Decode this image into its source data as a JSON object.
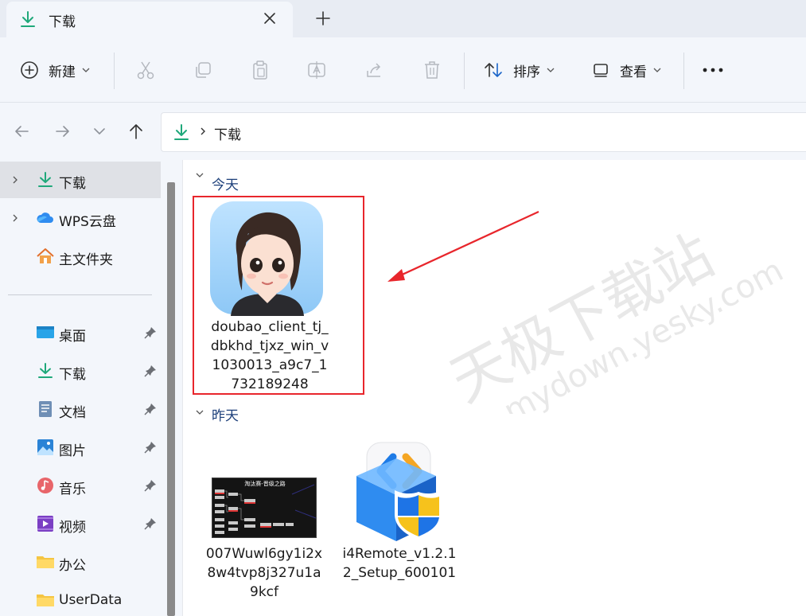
{
  "window": {
    "tab_title": "下载",
    "colors": {
      "accent_green": "#1fa87a",
      "selection_red": "#e8262c",
      "group_title": "#1c3f7a"
    }
  },
  "toolbar": {
    "new_label": "新建",
    "sort_label": "排序",
    "view_label": "查看"
  },
  "address": {
    "path": "下载"
  },
  "sidebar": {
    "items": [
      {
        "label": "下载",
        "icon": "download-arrow-icon"
      },
      {
        "label": "WPS云盘",
        "icon": "cloud-icon"
      },
      {
        "label": "主文件夹",
        "icon": "home-icon"
      },
      {
        "label": "桌面",
        "icon": "desktop-icon"
      },
      {
        "label": "下载",
        "icon": "download-arrow-icon"
      },
      {
        "label": "文档",
        "icon": "document-icon"
      },
      {
        "label": "图片",
        "icon": "picture-icon"
      },
      {
        "label": "音乐",
        "icon": "music-icon"
      },
      {
        "label": "视频",
        "icon": "video-icon"
      },
      {
        "label": "办公",
        "icon": "folder-icon"
      },
      {
        "label": "UserData",
        "icon": "folder-icon"
      }
    ]
  },
  "groups": {
    "today": {
      "title": "今天",
      "files": [
        {
          "name": "doubao_client_tj_dbkhd_tjxz_win_v1030013_a9c7_1732189248",
          "icon": "doubao-avatar-icon"
        }
      ]
    },
    "yesterday": {
      "title": "昨天",
      "files": [
        {
          "name": "007Wuwl6gy1i2x8w4tvp8j327u1a9kcf",
          "icon": "image-thumbnail",
          "thumb_caption": "淘汰赛-晋级之路"
        },
        {
          "name": "i4Remote_v1.2.12_Setup_600101",
          "icon": "i4remote-installer-icon"
        }
      ]
    }
  },
  "watermark": {
    "line1": "天极下载站",
    "line2": "mydown.yesky.com"
  }
}
